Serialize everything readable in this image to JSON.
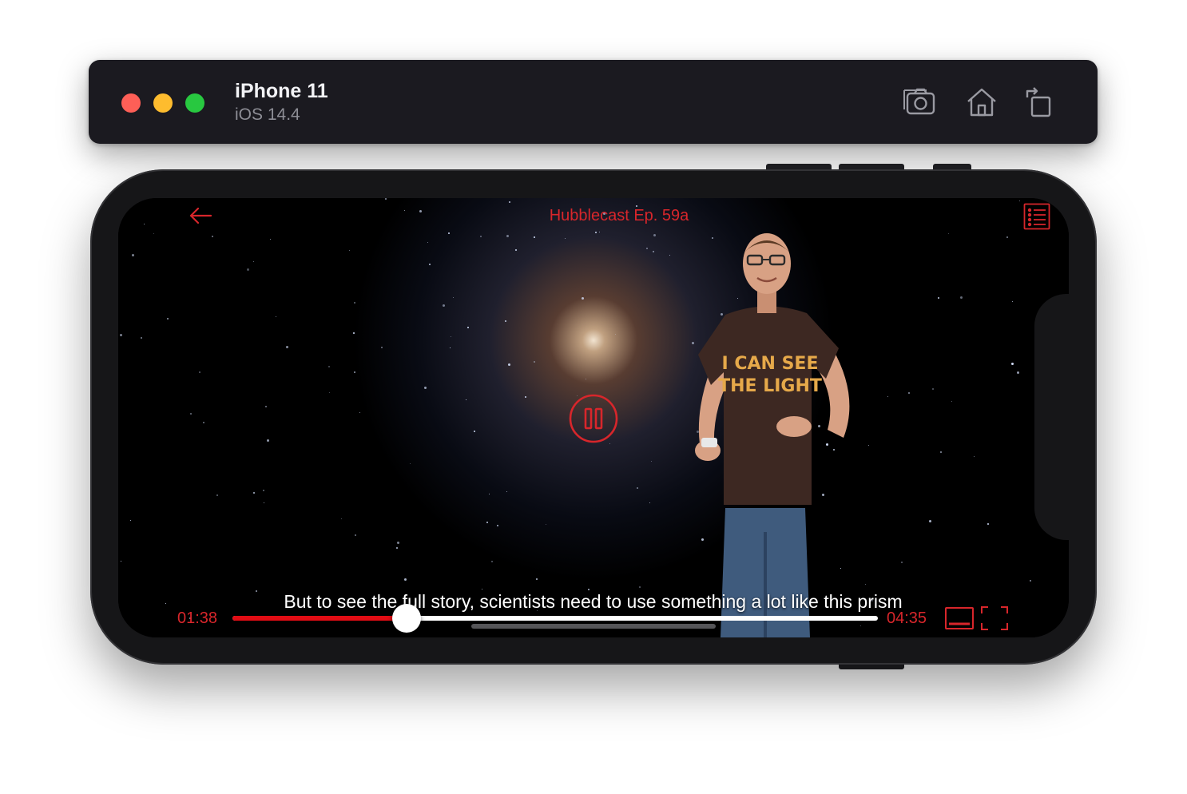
{
  "simulator": {
    "device_name": "iPhone 11",
    "os_version": "iOS 14.4",
    "toolbar_icons": [
      "screenshot-icon",
      "home-icon",
      "rotate-icon"
    ]
  },
  "player": {
    "title": "Hubblecast Ep. 59a",
    "subtitle": "But to see the full story, scientists need to use something a lot like this prism",
    "current_time": "01:38",
    "total_time": "04:35",
    "progress": 0.27,
    "state": "playing",
    "accent_color": "#d8262b",
    "icons": [
      "back-arrow-icon",
      "playlist-icon",
      "pause-icon",
      "subtitles-icon",
      "fullscreen-icon"
    ]
  },
  "presenter_shirt": {
    "line1": "I CAN SEE",
    "line2": "THE LIGHT"
  }
}
